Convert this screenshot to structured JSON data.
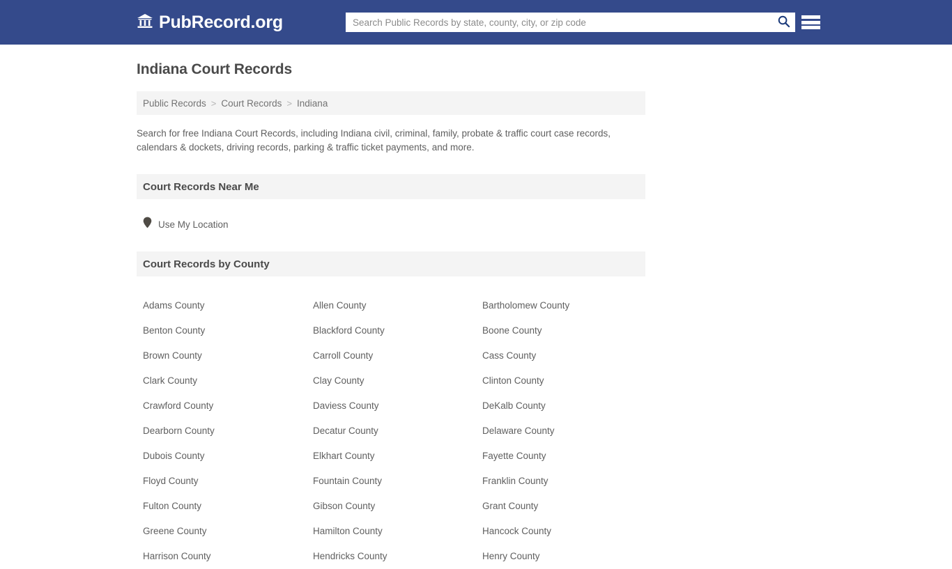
{
  "header": {
    "brand_name": "PubRecord.org",
    "brand_icon": "bank-building-icon",
    "search": {
      "placeholder": "Search Public Records by state, county, city, or zip code",
      "value": "",
      "search_icon": "search-icon"
    },
    "menu_icon": "hamburger-menu-icon",
    "background_color": "#344a8b"
  },
  "main": {
    "page_title": "Indiana Court Records",
    "breadcrumb": {
      "separator": ">",
      "items": [
        {
          "label": "Public Records"
        },
        {
          "label": "Court Records"
        },
        {
          "label": "Indiana"
        }
      ]
    },
    "intro": "Search for free Indiana Court Records, including Indiana civil, criminal, family, probate & traffic court case records, calendars & dockets, driving records, parking & traffic ticket payments, and more.",
    "near_me": {
      "section_title": "Court Records Near Me",
      "location_icon": "map-pin-icon",
      "location_label": "Use My Location"
    },
    "by_county": {
      "section_title": "Court Records by County",
      "counties": [
        "Adams County",
        "Allen County",
        "Bartholomew County",
        "Benton County",
        "Blackford County",
        "Boone County",
        "Brown County",
        "Carroll County",
        "Cass County",
        "Clark County",
        "Clay County",
        "Clinton County",
        "Crawford County",
        "Daviess County",
        "DeKalb County",
        "Dearborn County",
        "Decatur County",
        "Delaware County",
        "Dubois County",
        "Elkhart County",
        "Fayette County",
        "Floyd County",
        "Fountain County",
        "Franklin County",
        "Fulton County",
        "Gibson County",
        "Grant County",
        "Greene County",
        "Hamilton County",
        "Hancock County",
        "Harrison County",
        "Hendricks County",
        "Henry County"
      ]
    }
  }
}
